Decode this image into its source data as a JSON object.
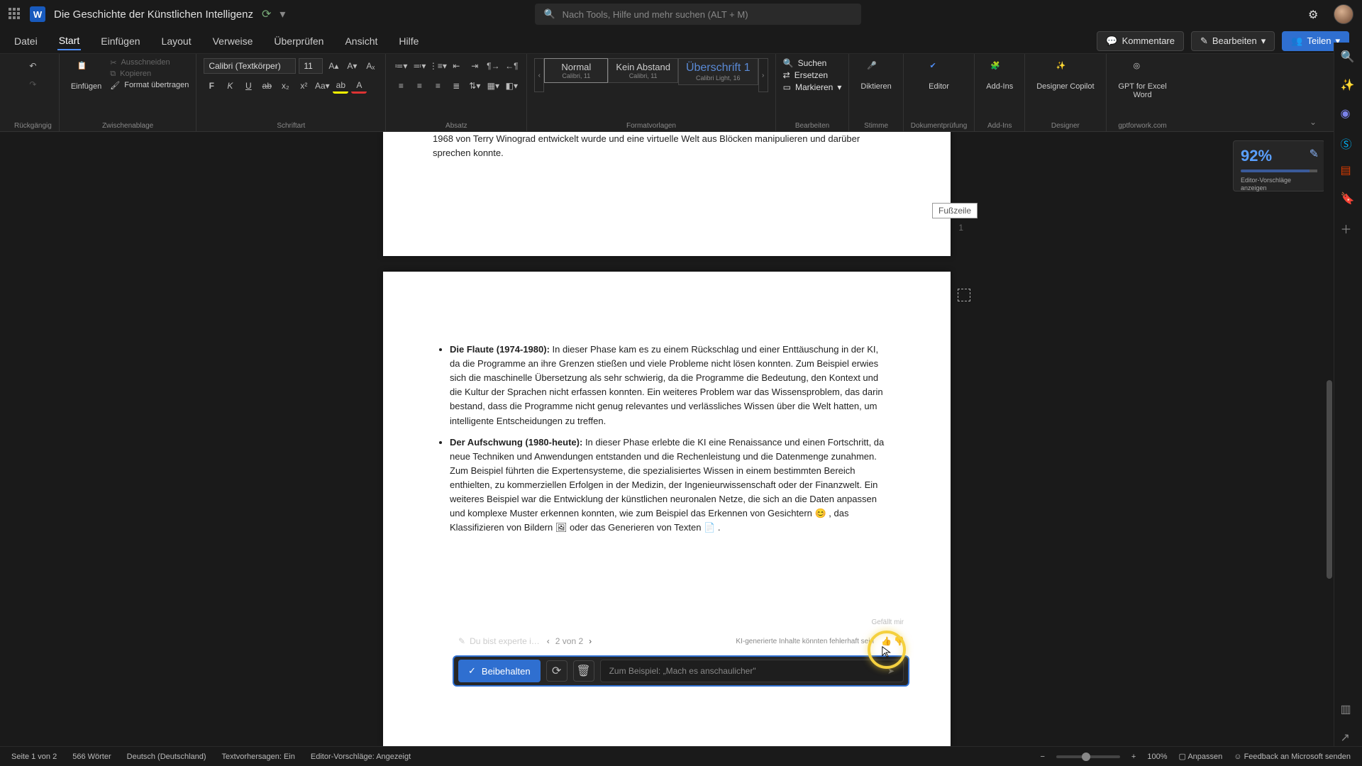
{
  "titlebar": {
    "doc_title": "Die Geschichte der Künstlichen Intelligenz",
    "search_placeholder": "Nach Tools, Hilfe und mehr suchen (ALT + M)",
    "word_glyph": "W"
  },
  "menubar": {
    "tabs": [
      "Datei",
      "Start",
      "Einfügen",
      "Layout",
      "Verweise",
      "Überprüfen",
      "Ansicht",
      "Hilfe"
    ],
    "active_index": 1,
    "comments": "Kommentare",
    "edit": "Bearbeiten",
    "share": "Teilen"
  },
  "ribbon": {
    "undo_group": "Rückgängig",
    "clipboard": {
      "paste": "Einfügen",
      "cut": "Ausschneiden",
      "copy": "Kopieren",
      "format_painter": "Format übertragen",
      "label": "Zwischenablage"
    },
    "font": {
      "family": "Calibri (Textkörper)",
      "size": "11",
      "label": "Schriftart"
    },
    "paragraph": {
      "label": "Absatz"
    },
    "styles": {
      "label": "Formatvorlagen",
      "items": [
        {
          "name": "Normal",
          "sub": "Calibri, 11"
        },
        {
          "name": "Kein Abstand",
          "sub": "Calibri, 11"
        },
        {
          "name": "Überschrift 1",
          "sub": "Calibri Light, 16"
        }
      ]
    },
    "editing": {
      "find": "Suchen",
      "replace": "Ersetzen",
      "select": "Markieren",
      "label": "Bearbeiten"
    },
    "dictate": {
      "btn": "Diktieren",
      "label": "Stimme"
    },
    "editor": {
      "btn": "Editor",
      "label": "Dokumentprüfung"
    },
    "addins": {
      "btn": "Add-Ins",
      "label": "Add-Ins"
    },
    "designer": {
      "btn": "Designer Copilot",
      "label": "Designer"
    },
    "gpt": {
      "btn": "GPT for Excel Word",
      "label": "gptforwork.com"
    }
  },
  "document": {
    "page1_tail": "1968 von Terry Winograd entwickelt wurde und eine virtuelle Welt aus Blöcken manipulieren und darüber sprechen konnte.",
    "footer_label": "Fußzeile",
    "page1_num": "1",
    "bullets": [
      {
        "title": "Die Flaute (1974-1980):",
        "text": " In dieser Phase kam es zu einem Rückschlag und einer Enttäuschung in der KI, da die Programme an ihre Grenzen stießen und viele Probleme nicht lösen konnten. Zum Beispiel erwies sich die maschinelle Übersetzung als sehr schwierig, da die Programme die Bedeutung, den Kontext und die Kultur der Sprachen nicht erfassen konnten. Ein weiteres Problem war das Wissensproblem, das darin bestand, dass die Programme nicht genug relevantes und verlässliches Wissen über die Welt hatten, um intelligente Entscheidungen zu treffen."
      },
      {
        "title": "Der Aufschwung (1980-heute):",
        "text": " In dieser Phase erlebte die KI eine Renaissance und einen Fortschritt, da neue Techniken und Anwendungen entstanden und die Rechenleistung und die Datenmenge zunahmen. Zum Beispiel führten die Expertensysteme, die spezialisiertes Wissen in einem bestimmten Bereich enthielten, zu kommerziellen Erfolgen in der Medizin, der Ingenieurwissenschaft oder der Finanzwelt. Ein weiteres Beispiel war die Entwicklung der künstlichen neuronalen Netze, die sich an die Daten anpassen und komplexe Muster erkennen konnten, wie zum Beispiel das Erkennen von Gesichtern 😊 , das Klassifizieren von Bildern 🖼 oder das Generieren von Texten 📄 ."
      }
    ]
  },
  "editor_panel": {
    "score": "92%",
    "suggestion": "Editor-Vorschläge anzeigen"
  },
  "copilot": {
    "prompt_chip": "Du bist experte i…",
    "pager": "2 von 2",
    "disclaimer": "KI-generierte Inhalte könnten fehlerhaft sein",
    "feedback_tooltip": "Gefällt mir",
    "keep": "Beibehalten",
    "input_placeholder": "Zum Beispiel: „Mach es anschaulicher\""
  },
  "statusbar": {
    "page": "Seite 1 von 2",
    "words": "566 Wörter",
    "lang": "Deutsch (Deutschland)",
    "predictions": "Textvorhersagen: Ein",
    "editor_status": "Editor-Vorschläge: Angezeigt",
    "zoom": "100%",
    "fit": "Anpassen",
    "feedback": "Feedback an Microsoft senden"
  }
}
